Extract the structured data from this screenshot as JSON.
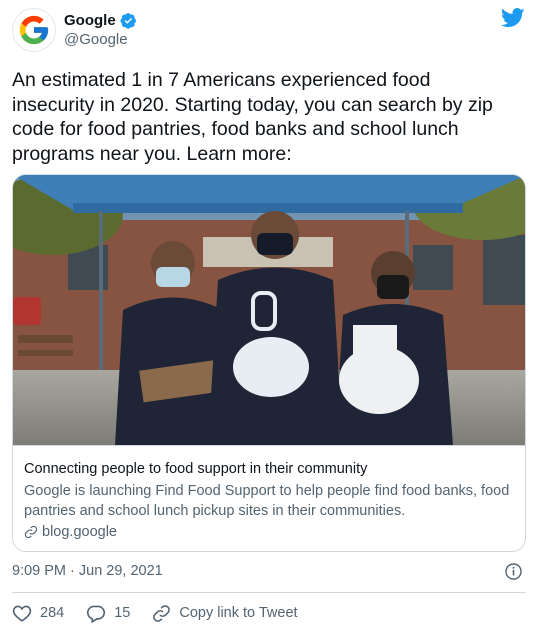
{
  "author": {
    "name": "Google",
    "handle": "@Google",
    "avatar_icon": "google-g-logo",
    "verified": true
  },
  "tweet": {
    "text": "An estimated 1 in 7 Americans experienced food insecurity in 2020. Starting today, you can search by zip code for food pantries, food banks and school lunch programs near you. Learn more:",
    "timestamp": "9:09 PM · Jun 29, 2021"
  },
  "card": {
    "title": "Connecting people to food support in their community",
    "description": "Google is launching Find Food Support to help people find food banks, food pantries and school lunch pickup sites in their communities.",
    "domain": "blog.google",
    "image_icon": "photo-three-volunteers-with-food-bags"
  },
  "actions": {
    "likes": "284",
    "replies": "15",
    "copy_link_label": "Copy link to Tweet"
  },
  "colors": {
    "twitter_blue": "#1d9bf0",
    "text_primary": "#0f1419",
    "text_secondary": "#536471",
    "border": "#cfd9de"
  }
}
